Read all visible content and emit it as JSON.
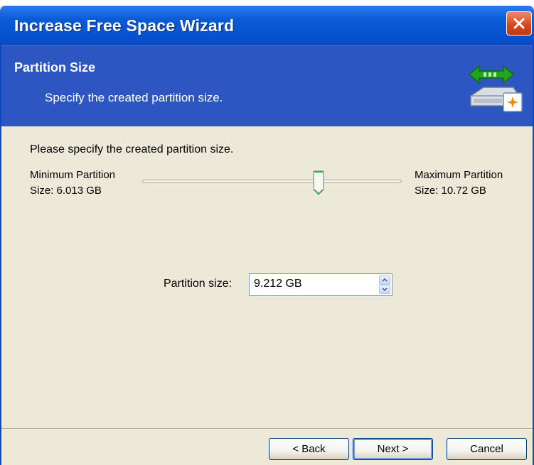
{
  "window": {
    "title": "Increase Free Space Wizard"
  },
  "header": {
    "title": "Partition Size",
    "subtitle": "Specify the created partition size."
  },
  "content": {
    "instruction": "Please specify the created partition size.",
    "min_label_line1": "Minimum Partition",
    "min_label_line2": "Size: 6.013 GB",
    "max_label_line1": "Maximum Partition",
    "max_label_line2": "Size: 10.72 GB",
    "slider_min_gb": 6.013,
    "slider_max_gb": 10.72,
    "slider_value_gb": 9.212,
    "size_label": "Partition size:",
    "size_value": "9.212 GB"
  },
  "buttons": {
    "back": "< Back",
    "next": "Next >",
    "cancel": "Cancel"
  },
  "colors": {
    "titlebar_blue": "#0752D0",
    "header_blue": "#2E56C2",
    "dialog_bg": "#ECE9D8",
    "close_red": "#D34618",
    "arrow_green": "#22A41C"
  },
  "icons": {
    "close": "close-icon",
    "wizard": "disk-resize-icon",
    "spin_up": "chevron-up-icon",
    "spin_down": "chevron-down-icon"
  }
}
